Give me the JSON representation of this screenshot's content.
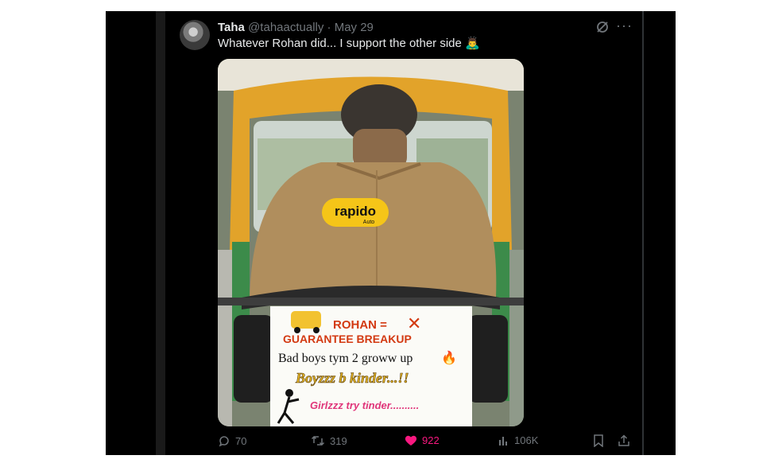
{
  "tweet": {
    "display_name": "Taha",
    "handle": "@tahaactually",
    "separator": "·",
    "date": "May 29",
    "text": "Whatever Rohan did... I support the other side 🙇‍♂️"
  },
  "media": {
    "jacket_logo": "rapido",
    "jacket_sub": "Auto",
    "sign_line1": "ROHAN =",
    "sign_line2": "GUARANTEE BREAKUP",
    "sign_line3": "Bad boys tym 2 groww up",
    "sign_line4": "Boyzzz b kinder...!!",
    "sign_line5": "Girlzzz try tinder..........",
    "cross_mark": "✕",
    "fire": "🔥"
  },
  "actions": {
    "replies": "70",
    "reposts": "319",
    "likes": "922",
    "views": "106K"
  },
  "icons": [
    "grok-icon",
    "more-icon",
    "reply-icon",
    "repost-icon",
    "like-icon",
    "views-icon",
    "bookmark-icon",
    "share-icon"
  ],
  "colors": {
    "background": "#000000",
    "text": "#e7e9ea",
    "muted": "#71767b",
    "like": "#f91880",
    "rapido_yellow": "#f5c518"
  }
}
